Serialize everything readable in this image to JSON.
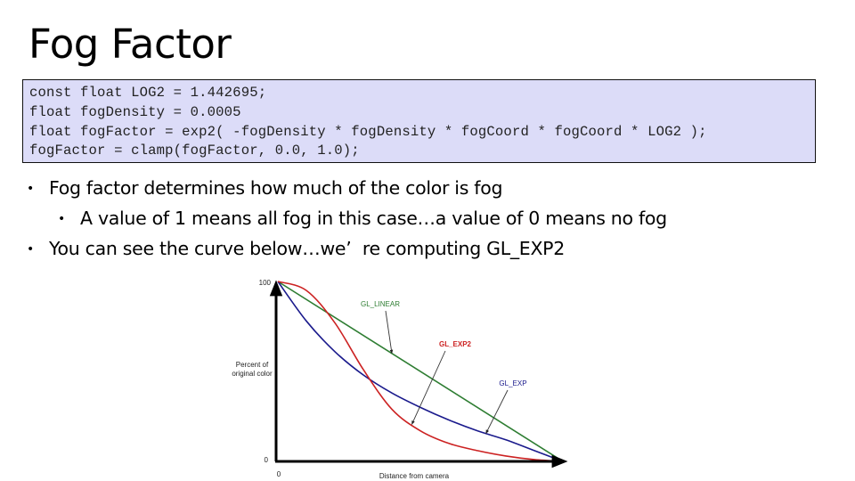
{
  "slide": {
    "title": "Fog Factor"
  },
  "code": {
    "lines": [
      "const float LOG2 = 1.442695;",
      "float fogDensity = 0.0005",
      "float fogFactor = exp2( -fogDensity * fogDensity * fogCoord * fogCoord * LOG2 );",
      "fogFactor = clamp(fogFactor, 0.0, 1.0);"
    ]
  },
  "bullets": [
    {
      "level": 1,
      "bullet": "•",
      "text": "Fog factor determines how much of the color is fog"
    },
    {
      "level": 2,
      "bullet": "•",
      "text": "A value of 1 means all fog in this case…a value of 0 means no fog"
    },
    {
      "level": 1,
      "bullet": "•",
      "text": "You can see the curve below…we’  re computing GL_EXP2"
    }
  ],
  "colors": {
    "code_background": "#dcdcf8",
    "linear": "#2e7d32",
    "exp": "#1a1a8c",
    "exp2": "#cc2222",
    "axis": "#000000"
  },
  "chart_data": {
    "type": "line",
    "title": "",
    "xlabel": "Distance from camera",
    "ylabel": "Percent of original color",
    "ylabel_lines": [
      "Percent of",
      "original color"
    ],
    "x_ticks": [
      "0"
    ],
    "y_ticks": [
      "0",
      "100"
    ],
    "xlim": [
      0,
      1
    ],
    "ylim": [
      0,
      100
    ],
    "grid": false,
    "series": [
      {
        "name": "GL_LINEAR",
        "color": "#2e7d32",
        "x": [
          0,
          0.1,
          0.2,
          0.3,
          0.4,
          0.5,
          0.6,
          0.7,
          0.8,
          0.9,
          1.0
        ],
        "values": [
          100,
          90,
          80,
          70,
          60,
          50,
          40,
          30,
          20,
          10,
          0
        ]
      },
      {
        "name": "GL_EXP",
        "color": "#1a1a8c",
        "x": [
          0,
          0.1,
          0.2,
          0.3,
          0.4,
          0.5,
          0.6,
          0.7,
          0.8,
          0.9,
          1.0
        ],
        "values": [
          100,
          78,
          61,
          48,
          38,
          30,
          23,
          17,
          12,
          6,
          0
        ]
      },
      {
        "name": "GL_EXP2",
        "color": "#cc2222",
        "x": [
          0,
          0.1,
          0.2,
          0.3,
          0.4,
          0.5,
          0.6,
          0.7,
          0.8,
          0.9,
          1.0
        ],
        "values": [
          100,
          95,
          77,
          51,
          29,
          17,
          10,
          6,
          3,
          1,
          0
        ]
      }
    ],
    "annotations": [
      {
        "label": "GL_LINEAR",
        "series": "GL_LINEAR",
        "points_to_x": 0.4
      },
      {
        "label": "GL_EXP2",
        "series": "GL_EXP2",
        "points_to_x": 0.47
      },
      {
        "label": "GL_EXP",
        "series": "GL_EXP",
        "points_to_x": 0.73
      }
    ]
  }
}
